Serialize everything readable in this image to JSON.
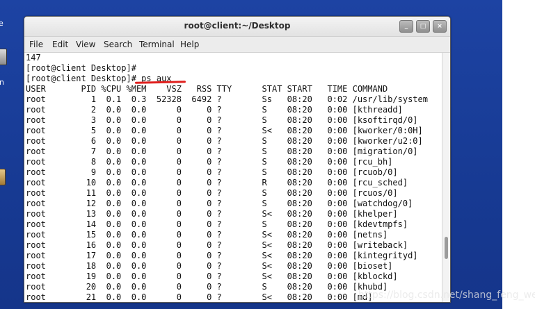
{
  "window": {
    "title": "root@client:~/Desktop",
    "min_glyph": "_",
    "max_glyph": "□",
    "close_glyph": "×"
  },
  "menu": [
    "File",
    "Edit",
    "View",
    "Search",
    "Terminal",
    "Help"
  ],
  "desktop": {
    "label_top": "e",
    "label_mid": "n"
  },
  "terminal": {
    "lines": [
      "147",
      "[root@client Desktop]#",
      "[root@client Desktop]# ps aux",
      "USER       PID %CPU %MEM    VSZ   RSS TTY      STAT START   TIME COMMAND",
      "root         1  0.1  0.3  52328  6492 ?        Ss   08:20   0:02 /usr/lib/system",
      "root         2  0.0  0.0      0     0 ?        S    08:20   0:00 [kthreadd]",
      "root         3  0.0  0.0      0     0 ?        S    08:20   0:00 [ksoftirqd/0]",
      "root         5  0.0  0.0      0     0 ?        S<   08:20   0:00 [kworker/0:0H]",
      "root         6  0.0  0.0      0     0 ?        S    08:20   0:00 [kworker/u2:0]",
      "root         7  0.0  0.0      0     0 ?        S    08:20   0:00 [migration/0]",
      "root         8  0.0  0.0      0     0 ?        S    08:20   0:00 [rcu_bh]",
      "root         9  0.0  0.0      0     0 ?        S    08:20   0:00 [rcuob/0]",
      "root        10  0.0  0.0      0     0 ?        R    08:20   0:00 [rcu_sched]",
      "root        11  0.0  0.0      0     0 ?        S    08:20   0:00 [rcuos/0]",
      "root        12  0.0  0.0      0     0 ?        S    08:20   0:00 [watchdog/0]",
      "root        13  0.0  0.0      0     0 ?        S<   08:20   0:00 [khelper]",
      "root        14  0.0  0.0      0     0 ?        S    08:20   0:00 [kdevtmpfs]",
      "root        15  0.0  0.0      0     0 ?        S<   08:20   0:00 [netns]",
      "root        16  0.0  0.0      0     0 ?        S<   08:20   0:00 [writeback]",
      "root        17  0.0  0.0      0     0 ?        S<   08:20   0:00 [kintegrityd]",
      "root        18  0.0  0.0      0     0 ?        S<   08:20   0:00 [bioset]",
      "root        19  0.0  0.0      0     0 ?        S<   08:20   0:00 [kblockd]",
      "root        20  0.0  0.0      0     0 ?        S    08:20   0:00 [khubd]",
      "root        21  0.0  0.0      0     0 ?        S<   08:20   0:00 [md]"
    ]
  },
  "watermark": "https://blog.csdn.net/shang_feng_wei",
  "colors": {
    "desktop": "#1b3f9a",
    "annotation": "#e0201e"
  }
}
